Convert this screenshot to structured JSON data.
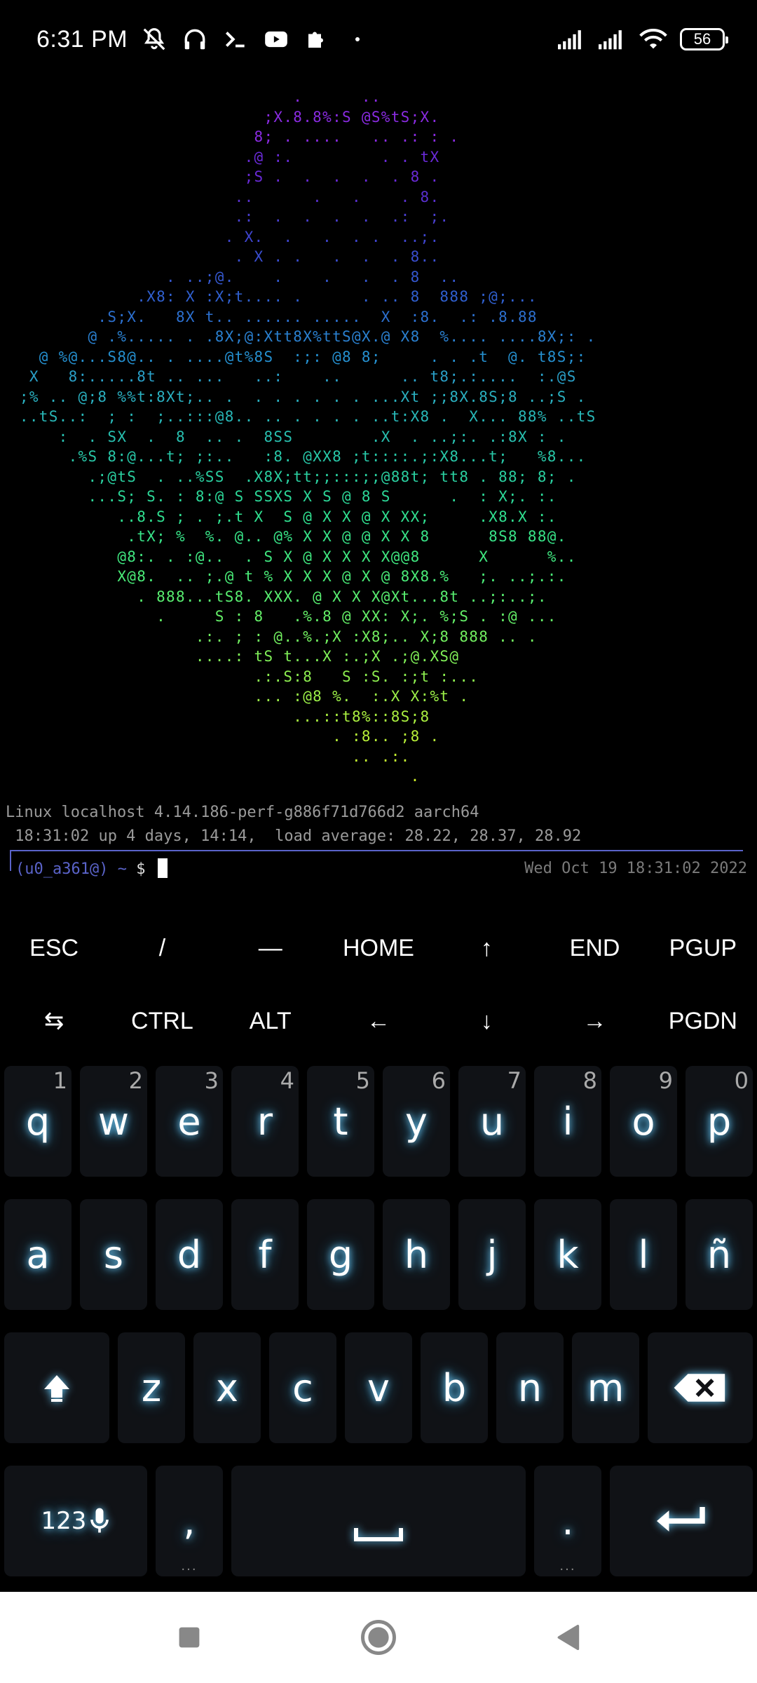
{
  "status_bar": {
    "time": "6:31 PM",
    "battery": "56",
    "icons": [
      "mute-icon",
      "headphones-icon",
      "terminal-icon",
      "youtube-icon",
      "puzzle-icon",
      "dot-icon",
      "signal-icon",
      "signal-icon",
      "wifi-icon",
      "battery-icon"
    ]
  },
  "terminal": {
    "art_lines": [
      {
        "color": "#8a2be2",
        "text": "                              .      .."
      },
      {
        "color": "#8a2be2",
        "text": "                           ;X.8.8%:S @S%tS;X."
      },
      {
        "color": "#8a2be2",
        "text": "                          8; . ....   .. .: : ."
      },
      {
        "color": "#6a2ad8",
        "text": "                         .@ :.         . . tX"
      },
      {
        "color": "#6a2ad8",
        "text": "                         ;S .  .  .  .  . 8 ."
      },
      {
        "color": "#5a30d0",
        "text": "                        ..      .   .    . 8."
      },
      {
        "color": "#4a3fd0",
        "text": "                        .:  .  .  .  .  .:  ;."
      },
      {
        "color": "#3f45d0",
        "text": "                       . X.  .   .  . .  ..;."
      },
      {
        "color": "#3a4ed0",
        "text": "                        . X . .   .  .  . 8.."
      },
      {
        "color": "#3558d0",
        "text": "                 . ..;@.    .    .   .  . 8  .."
      },
      {
        "color": "#3060d0",
        "text": "              .X8: X :X;t.... .      . .. 8  888 ;@;..."
      },
      {
        "color": "#2c70d0",
        "text": "          .S;X.   8X t.. ...... .....  X  :8.  .: .8.88"
      },
      {
        "color": "#2a80d0",
        "text": "         @ .%..... . .8X;@:Xtt8X%ttS@X.@ X8  %.... ....8X;: ."
      },
      {
        "color": "#2590d0",
        "text": "    @ %@...S8@.. . ....@t%8S  :;: @8 8;     . . .t  @. t8S;:"
      },
      {
        "color": "#2aa0c8",
        "text": "   X   8:.....8t .. ...   ..:    ..      .. t8;.:....  :.@S"
      },
      {
        "color": "#2ab0c0",
        "text": "  ;% .. @;8 %%t:8Xt;.. .  . . . . . . ...Xt ;;8X.8S;8 ..;S ."
      },
      {
        "color": "#28b8b8",
        "text": "  ..tS..:  ; :  ;..:::@8.. .. . . . . ..t:X8 .  X... 88% ..tS"
      },
      {
        "color": "#28c0b0",
        "text": "      :  . SX  .  8  .. .  8SS        .X  . ..;:. .:8X : ."
      },
      {
        "color": "#28c8a8",
        "text": "       .%S 8:@...t; ;:..   :8. @XX8 ;t::::.;:X8...t;   %8..."
      },
      {
        "color": "#2ad0a0",
        "text": "         .;@tS  . ..%SS  .X8X;tt;;:::;;@88t; tt8 . 88; 8; ."
      },
      {
        "color": "#2cd898",
        "text": "         ...S; S. : 8:@ S SSXS X S @ 8 S      .  : X;. :."
      },
      {
        "color": "#30e090",
        "text": "            ..8.S ; . ;.t X  S @ X X @ X XX;     .X8.X :."
      },
      {
        "color": "#38e488",
        "text": "             .tX; %  %. @.. @% X X @ @ X X 8      8S8 88@."
      },
      {
        "color": "#40e880",
        "text": "            @8:. . :@..  . S X @ X X X X@@8      X      %.."
      },
      {
        "color": "#4aec78",
        "text": "            X@8.  .. ;.@ t % X X X @ X @ 8X8.%   ;. ..;.:."
      },
      {
        "color": "#58ee70",
        "text": "              . 888...tS8. XXX. @ X X X@Xt...8t ..;:..;."
      },
      {
        "color": "#64f068",
        "text": "                .     S : 8   .%.8 @ XX: X;. %;S . :@ ..."
      },
      {
        "color": "#72f060",
        "text": "                    .:. ; : @..%.;X :X8;.. X;8 888 .. ."
      },
      {
        "color": "#80f058",
        "text": "                    ....: tS t...X :.;X .;@.XS@"
      },
      {
        "color": "#8ef050",
        "text": "                          .:.S:8   S :S. :;t :..."
      },
      {
        "color": "#9cf048",
        "text": "                          ... :@8 %.  :.X X:%t ."
      },
      {
        "color": "#aaf040",
        "text": "                              ...::t8%::8S;8"
      },
      {
        "color": "#b8f038",
        "text": "                                  . :8.. ;8 ."
      },
      {
        "color": "#c4f030",
        "text": "                                    .. .:."
      },
      {
        "color": "#d0f028",
        "text": "                                          ."
      }
    ],
    "sysinfo_line1": "Linux localhost 4.14.186-perf-g886f71d766d2 aarch64",
    "sysinfo_line2": " 18:31:02 up 4 days, 14:14,  load average: 28.22, 28.37, 28.92",
    "prompt_user": "(u0_a361@)",
    "prompt_path": " ~ ",
    "prompt_symbol": "$",
    "datetime": "Wed Oct 19 18:31:02 2022"
  },
  "extra_keys": {
    "row1": [
      "ESC",
      "/",
      "—",
      "HOME",
      "↑",
      "END",
      "PGUP"
    ],
    "row2": [
      "⇆",
      "CTRL",
      "ALT",
      "←",
      "↓",
      "→",
      "PGDN"
    ]
  },
  "keyboard": {
    "row1": [
      {
        "key": "q",
        "hint": "1"
      },
      {
        "key": "w",
        "hint": "2"
      },
      {
        "key": "e",
        "hint": "3"
      },
      {
        "key": "r",
        "hint": "4"
      },
      {
        "key": "t",
        "hint": "5"
      },
      {
        "key": "y",
        "hint": "6"
      },
      {
        "key": "u",
        "hint": "7"
      },
      {
        "key": "i",
        "hint": "8"
      },
      {
        "key": "o",
        "hint": "9"
      },
      {
        "key": "p",
        "hint": "0"
      }
    ],
    "row2": [
      "a",
      "s",
      "d",
      "f",
      "g",
      "h",
      "j",
      "k",
      "l",
      "ñ"
    ],
    "row3": [
      "z",
      "x",
      "c",
      "v",
      "b",
      "n",
      "m"
    ],
    "row4": {
      "numbers": "123",
      "comma": ",",
      "period": "."
    }
  }
}
